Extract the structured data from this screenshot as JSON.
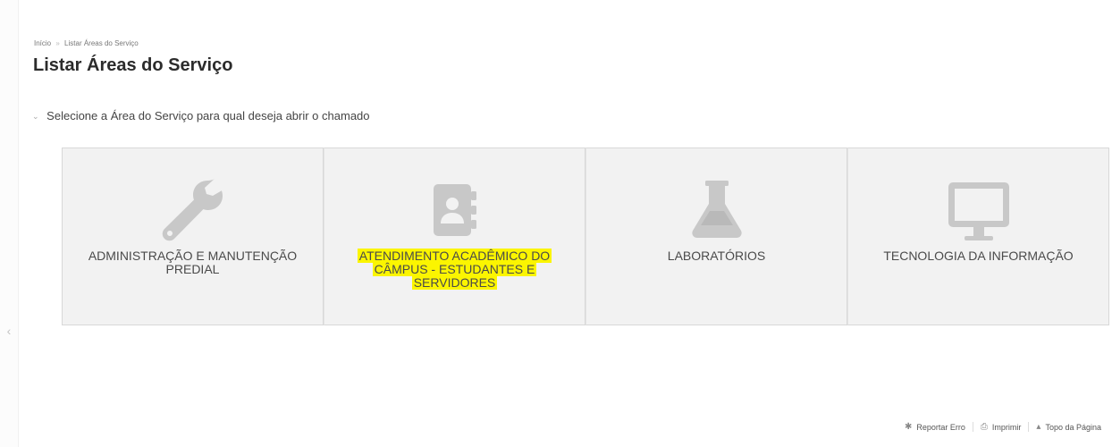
{
  "breadcrumb": {
    "home": "Início",
    "separator": "»",
    "current": "Listar Áreas do Serviço"
  },
  "page": {
    "title": "Listar Áreas do Serviço"
  },
  "section": {
    "chevron": "⌄",
    "label": "Selecione a Área do Serviço para qual deseja abrir o chamado"
  },
  "cards": [
    {
      "icon": "wrench-icon",
      "label": "ADMINISTRAÇÃO E MANUTENÇÃO PREDIAL",
      "highlighted": false
    },
    {
      "icon": "contact-book-icon",
      "label": "ATENDIMENTO ACADÊMICO DO CÂMPUS - ESTUDANTES E SERVIDORES",
      "highlighted": true
    },
    {
      "icon": "flask-icon",
      "label": "LABORATÓRIOS",
      "highlighted": false
    },
    {
      "icon": "monitor-icon",
      "label": "TECNOLOGIA DA INFORMAÇÃO",
      "highlighted": false
    }
  ],
  "footer": {
    "report_icon": "bug-icon",
    "report": "Reportar Erro",
    "print_icon": "printer-icon",
    "print": "Imprimir",
    "top_icon": "caret-up-icon",
    "top": "Topo da Página"
  },
  "left_rail": {
    "toggle_glyph": "‹"
  },
  "colors": {
    "highlight": "#fbf500",
    "card_bg": "#f2f2f2",
    "icon": "#c8c8c8"
  }
}
